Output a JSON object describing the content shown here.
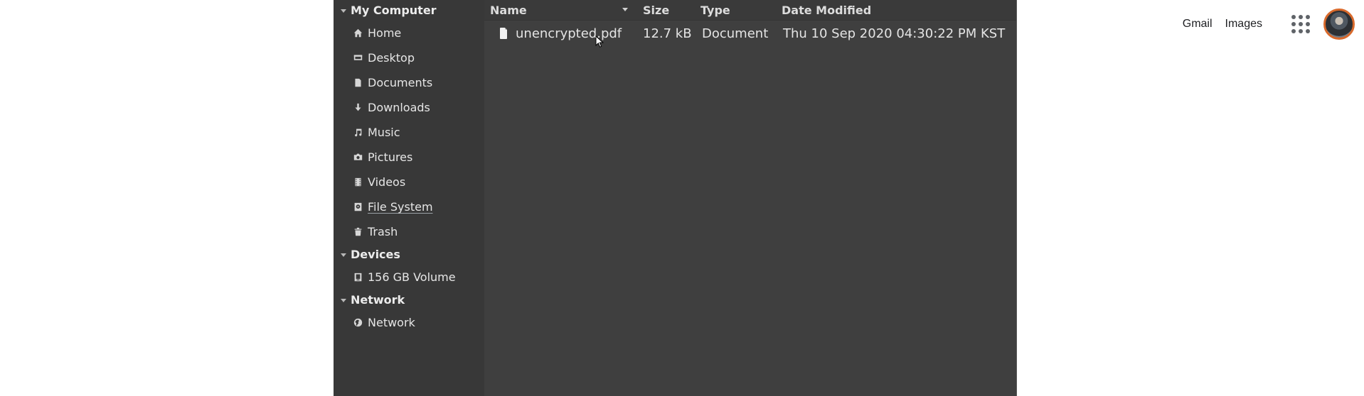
{
  "google_header": {
    "gmail_label": "Gmail",
    "images_label": "Images",
    "apps_icon": "apps-grid-icon",
    "avatar_icon": "account-avatar"
  },
  "file_manager": {
    "sidebar": {
      "my_computer": {
        "label": "My Computer",
        "items": [
          {
            "label": "Home",
            "icon": "home-icon"
          },
          {
            "label": "Desktop",
            "icon": "desktop-icon"
          },
          {
            "label": "Documents",
            "icon": "documents-icon"
          },
          {
            "label": "Downloads",
            "icon": "download-icon"
          },
          {
            "label": "Music",
            "icon": "music-icon"
          },
          {
            "label": "Pictures",
            "icon": "camera-icon"
          },
          {
            "label": "Videos",
            "icon": "film-icon"
          },
          {
            "label": "File System",
            "icon": "drive-icon"
          },
          {
            "label": "Trash",
            "icon": "trash-icon"
          }
        ]
      },
      "devices": {
        "label": "Devices",
        "items": [
          {
            "label": "156 GB Volume",
            "icon": "drive-icon"
          }
        ]
      },
      "network": {
        "label": "Network",
        "items": [
          {
            "label": "Network",
            "icon": "globe-icon"
          }
        ]
      }
    },
    "columns": {
      "name": "Name",
      "size": "Size",
      "type": "Type",
      "date": "Date Modified"
    },
    "files": [
      {
        "name": "unencrypted.pdf",
        "size": "12.7 kB",
        "type": "Document",
        "date": "Thu 10 Sep 2020 04:30:22 PM KST",
        "icon": "file-icon"
      }
    ]
  }
}
